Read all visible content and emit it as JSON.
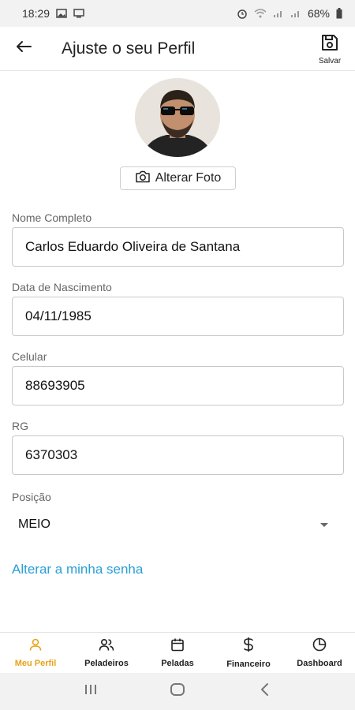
{
  "status_bar": {
    "time": "18:29",
    "battery": "68%",
    "left_icons": [
      "image-icon",
      "monitor-icon"
    ],
    "right_icons": [
      "alarm-icon",
      "wifi-icon",
      "signal-icon",
      "signal-icon",
      "battery-icon"
    ]
  },
  "header": {
    "title": "Ajuste o seu Perfil",
    "save_label": "Salvar",
    "back_icon": "arrow-left-icon",
    "save_icon": "floppy-disk-icon"
  },
  "profile": {
    "change_photo_label": "Alterar Foto",
    "camera_icon": "camera-icon"
  },
  "form": {
    "full_name": {
      "label": "Nome Completo",
      "value": "Carlos Eduardo Oliveira de Santana"
    },
    "birth_date": {
      "label": "Data de Nascimento",
      "value": "04/11/1985"
    },
    "phone": {
      "label": "Celular",
      "value": "88693905"
    },
    "rg": {
      "label": "RG",
      "value": "6370303"
    },
    "position": {
      "label": "Posição",
      "value": "MEIO"
    }
  },
  "change_password_label": "Alterar a minha senha",
  "bottom_nav": {
    "items": [
      {
        "label": "Meu Perfil",
        "icon": "user-icon",
        "active": true
      },
      {
        "label": "Peladeiros",
        "icon": "users-icon",
        "active": false
      },
      {
        "label": "Peladas",
        "icon": "calendar-icon",
        "active": false
      },
      {
        "label": "Financeiro",
        "icon": "dollar-icon",
        "active": false
      },
      {
        "label": "Dashboard",
        "icon": "pie-chart-icon",
        "active": false
      }
    ]
  },
  "colors": {
    "accent_active": "#e8a317",
    "link": "#2a9fd6"
  }
}
